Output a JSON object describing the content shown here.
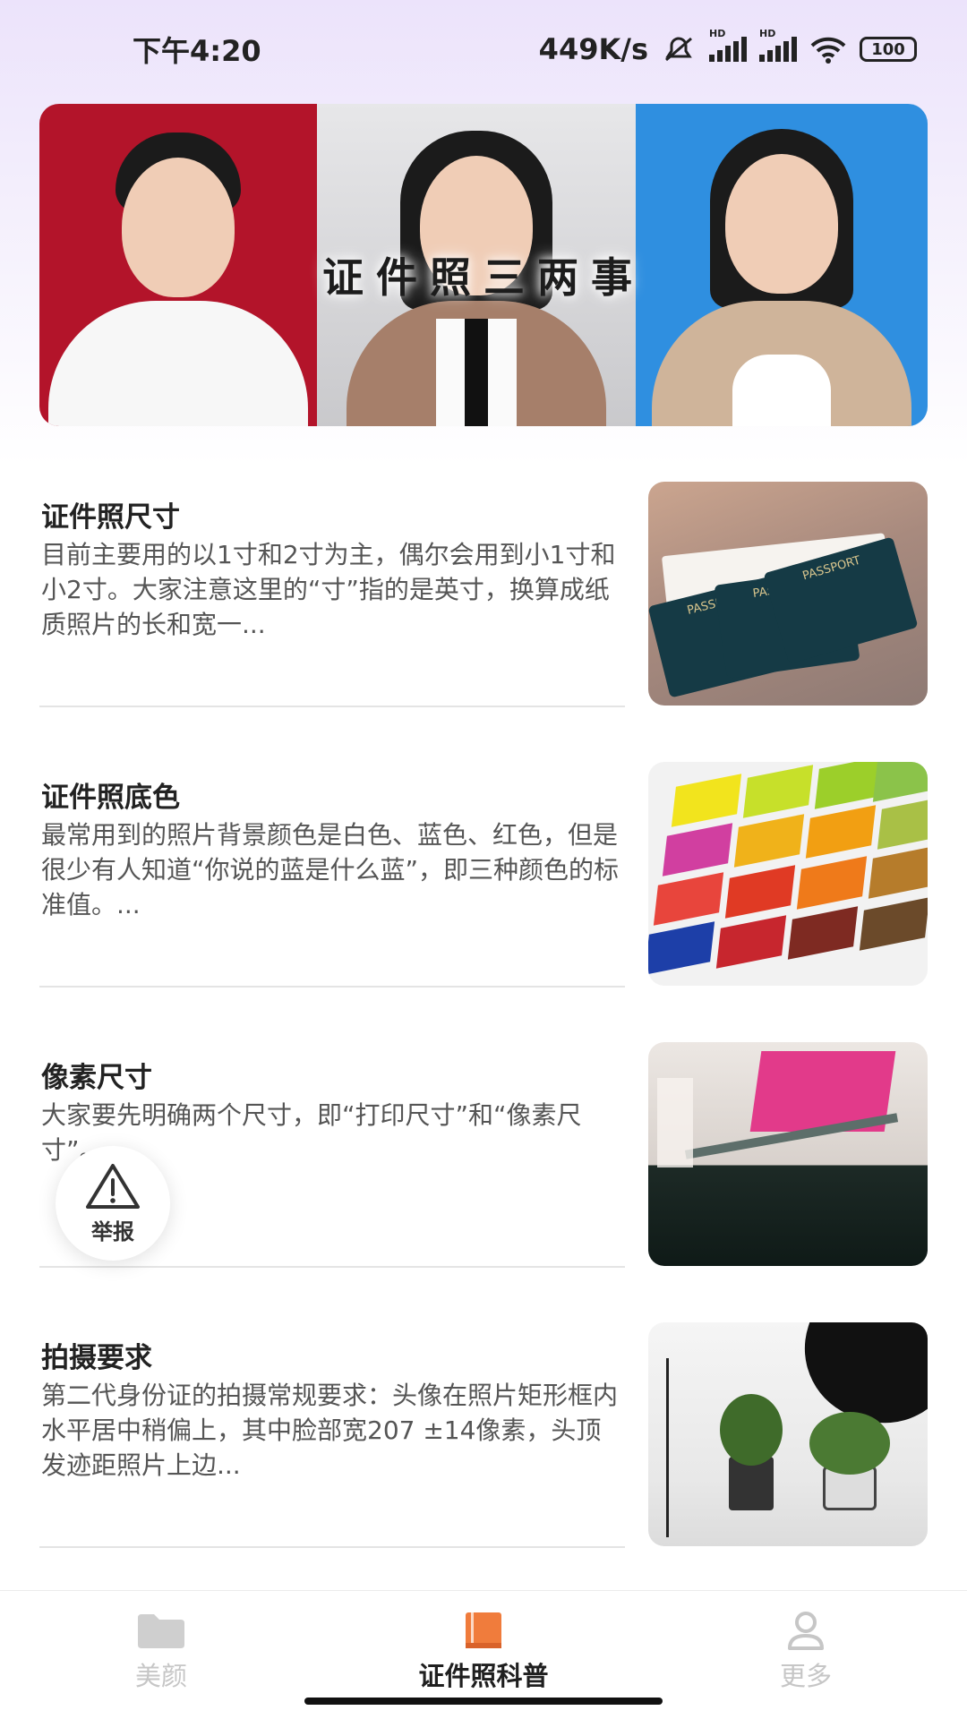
{
  "status_bar": {
    "time": "下午4:20",
    "network_speed": "449K/s",
    "battery": "100",
    "signal_tag": "HD"
  },
  "banner": {
    "title": "证件照三两事"
  },
  "articles": [
    {
      "title": "证件照尺寸",
      "summary": "目前主要用的以1寸和2寸为主，偶尔会用到小1寸和小2寸。大家注意这里的“寸”指的是英寸，换算成纸质照片的长和宽一...",
      "image": "passport-thumbnail"
    },
    {
      "title": "证件照底色",
      "summary": "最常用到的照片背景颜色是白色、蓝色、红色，但是很少有人知道“你说的蓝是什么蓝”，即三种颜色的标准值。...",
      "image": "color-swatches-thumbnail"
    },
    {
      "title": "像素尺寸",
      "summary": "大家要先明确两个尺寸，即“打印尺寸”和“像素尺寸”。",
      "image": "printing-press-thumbnail"
    },
    {
      "title": "拍摄要求",
      "summary": "第二代身份证的拍摄常规要求：头像在照片矩形框内水平居中稍偏上，其中脸部宽207 ±14像素，头顶发迹距照片上边...",
      "image": "photo-studio-thumbnail"
    }
  ],
  "passport_text": "PASSPORT",
  "report_button": {
    "label": "举报"
  },
  "bottom_nav": {
    "items": [
      {
        "label": "美颜",
        "icon": "folder-icon",
        "active": false
      },
      {
        "label": "证件照科普",
        "icon": "book-icon",
        "active": true
      },
      {
        "label": "更多",
        "icon": "person-icon",
        "active": false
      }
    ]
  },
  "colors": {
    "accent_orange": "#f07c3c",
    "nav_inactive": "#c6c6c6",
    "banner_red": "#b3142a",
    "banner_blue": "#2f8fe0"
  }
}
